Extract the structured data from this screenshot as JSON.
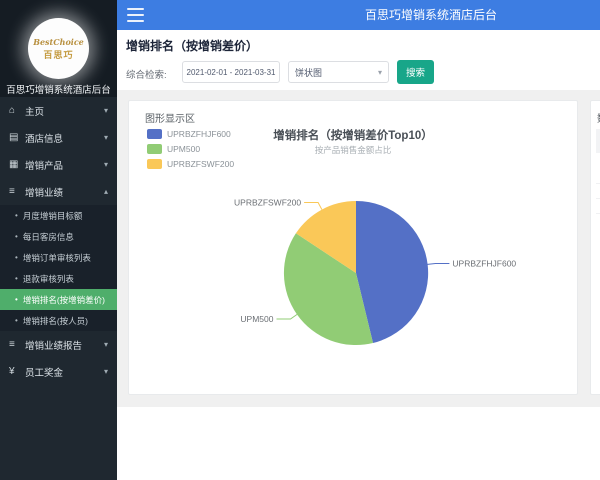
{
  "topbar": {
    "title": "百思巧增销系统酒店后台"
  },
  "sidebar": {
    "brand_line1": "BestChoice",
    "brand_line2": "百思巧",
    "caption": "百思巧增销系统酒店后台",
    "items": [
      {
        "label": "主页",
        "icon": "home-icon",
        "glyph": "⌂",
        "chevron": "▾",
        "expanded": false
      },
      {
        "label": "酒店信息",
        "icon": "hotel-info-icon",
        "glyph": "▤",
        "chevron": "▾",
        "expanded": false
      },
      {
        "label": "增销产品",
        "icon": "product-icon",
        "glyph": "▦",
        "chevron": "▾",
        "expanded": false
      },
      {
        "label": "增销业绩",
        "icon": "performance-icon",
        "glyph": "≡",
        "chevron": "▴",
        "expanded": true
      },
      {
        "label": "增销业绩报告",
        "icon": "report-icon",
        "glyph": "≡",
        "chevron": "▾",
        "expanded": false
      },
      {
        "label": "员工奖金",
        "icon": "bonus-icon",
        "glyph": "¥",
        "chevron": "▾",
        "expanded": false
      }
    ],
    "submenu_items": [
      {
        "label": "月度增销目标额",
        "active": false
      },
      {
        "label": "每日客房信息",
        "active": false
      },
      {
        "label": "增销订单审核列表",
        "active": false
      },
      {
        "label": "退款审核列表",
        "active": false
      },
      {
        "label": "增销排名(按增销差价)",
        "active": true
      },
      {
        "label": "增销排名(按人员)",
        "active": false
      }
    ]
  },
  "page": {
    "title": "增销排名（按增销差价）",
    "search_label": "综合检索:",
    "date_range_value": "2021-02-01 - 2021-03-31",
    "chart_type_value": "饼状图",
    "search_button_label": "搜索"
  },
  "chart_panel": {
    "header": "图形显示区"
  },
  "right_panel": {
    "partial_header": "数"
  },
  "icons": {
    "dropdown_chevron": "▾"
  },
  "colors": {
    "topbar_blue": "#3d7de2",
    "sidebar_bg": "#1f2830",
    "active_green": "#4fae6b",
    "button_teal": "#18a689",
    "pie_blue": "#5470c6",
    "pie_green": "#91cc75",
    "pie_yellow": "#fac858"
  },
  "chart_data": {
    "type": "pie",
    "title": "增销排名（按增销差价Top10）",
    "subtitle": "按产品销售金额占比",
    "legend_position": "top-left-vertical",
    "start_angle_deg": 0,
    "series": [
      {
        "name": "UPRBZFHJF600",
        "percent": 46.2,
        "color": "#5470c6"
      },
      {
        "name": "UPM500",
        "percent": 38.1,
        "color": "#91cc75"
      },
      {
        "name": "UPRBZFSWF200",
        "percent": 15.7,
        "color": "#fac858"
      }
    ]
  }
}
